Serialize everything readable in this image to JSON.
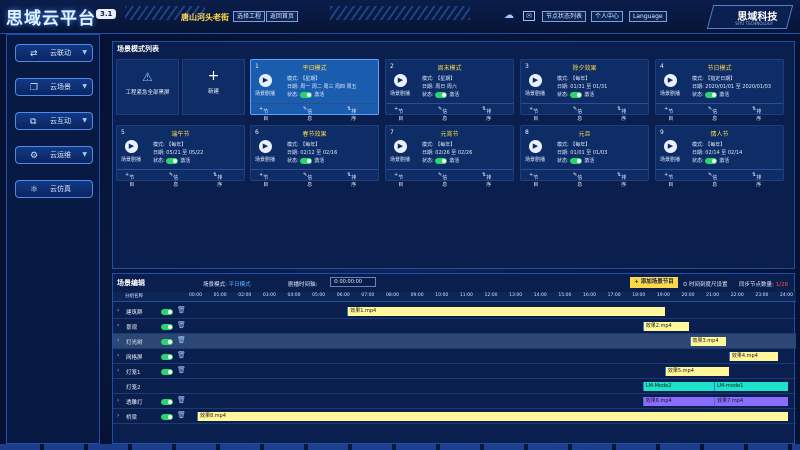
{
  "header": {
    "logo": "思域云平台",
    "version": "3.1",
    "location": "唐山河头老街",
    "btn_select": "选择工程",
    "btn_home": "返回首页",
    "btn_node_status": "节点状态列表",
    "btn_user": "个人中心",
    "btn_lang": "Language",
    "brand_name": "思域科技",
    "brand_sub": "SIYU TECHNOLOGY"
  },
  "sidebar": {
    "items": [
      {
        "label": "云联动",
        "icon": "link-icon"
      },
      {
        "label": "云场景",
        "icon": "scene-icon"
      },
      {
        "label": "云互动",
        "icon": "interact-icon"
      },
      {
        "label": "云运维",
        "icon": "maintain-icon"
      },
      {
        "label": "云仿真",
        "icon": "simulate-icon"
      }
    ]
  },
  "scenes": {
    "title": "场景模式列表",
    "emergency_label": "工程紧急全部黑屏",
    "add_label": "新建",
    "play_label": "场景剧播",
    "mode_prefix": "模式:",
    "date_prefix": "日期:",
    "status_prefix": "状态:",
    "status_value": "激活",
    "act_node": "节目",
    "act_info": "信息",
    "act_sort": "排序",
    "cards": [
      {
        "num": "1",
        "name": "平日模式",
        "mode": "【星期】",
        "date": "周一 周二 周三 周四 周五",
        "selected": true
      },
      {
        "num": "2",
        "name": "周末模式",
        "mode": "【星期】",
        "date": "周日 周六"
      },
      {
        "num": "3",
        "name": "除夕效果",
        "mode": "【每年】",
        "date": "01/31 至 01/31"
      },
      {
        "num": "4",
        "name": "节日模式",
        "mode": "【指定日期】",
        "date": "2020/01/01 至 2020/01/03"
      },
      {
        "num": "5",
        "name": "端午节",
        "mode": "【每年】",
        "date": "05/21 至 05/22"
      },
      {
        "num": "6",
        "name": "春节效果",
        "mode": "【每年】",
        "date": "02/12 至 02/16"
      },
      {
        "num": "7",
        "name": "元宵节",
        "mode": "【每年】",
        "date": "02/26 至 02/26"
      },
      {
        "num": "8",
        "name": "元旦",
        "mode": "【每年】",
        "date": "01/01 至 01/03"
      },
      {
        "num": "9",
        "name": "情人节",
        "mode": "【每年】",
        "date": "02/14 至 02/14"
      }
    ]
  },
  "editor": {
    "title": "场景编辑",
    "mode_label": "场景模式:",
    "mode_value": "平日模式",
    "time_label": "剧播时间轴:",
    "time_value": "00:00:00",
    "add_node_btn": "+ 添加场景节目",
    "axis_settings": "时间刻度尺设置",
    "sync_label": "同步节点数量:",
    "sync_value": "1/28",
    "group_header": "分组名称",
    "ticks": [
      "00:00",
      "01:00",
      "02:00",
      "03:00",
      "04:00",
      "05:00",
      "06:00",
      "07:00",
      "08:00",
      "09:00",
      "10:00",
      "11:00",
      "12:00",
      "13:00",
      "14:00",
      "15:00",
      "16:00",
      "17:00",
      "18:00",
      "19:00",
      "20:00",
      "21:00",
      "22:00",
      "23:00",
      "24:00"
    ],
    "rows": [
      {
        "name": "建筑群",
        "expand": true,
        "toggle": true,
        "bars": [
          {
            "label": "效果1.mp4",
            "start": 6.1,
            "end": 19.0,
            "color": "#fff79a"
          }
        ]
      },
      {
        "name": "景观",
        "expand": true,
        "toggle": true,
        "bars": [
          {
            "label": "效果2.mp4",
            "start": 18.1,
            "end": 20.0,
            "color": "#fff79a"
          }
        ]
      },
      {
        "name": "灯光树",
        "expand": true,
        "toggle": true,
        "highlight": true,
        "bars": [
          {
            "label": "效果3.mp4",
            "start": 20.0,
            "end": 21.5,
            "color": "#fff79a"
          }
        ]
      },
      {
        "name": "网格屏",
        "expand": true,
        "toggle": true,
        "bars": [
          {
            "label": "效果4.mp4",
            "start": 21.6,
            "end": 23.6,
            "color": "#fff79a"
          }
        ]
      },
      {
        "name": "灯笼1",
        "expand": true,
        "toggle": true,
        "bars": [
          {
            "label": "效果5.mp4",
            "start": 19.0,
            "end": 21.6,
            "color": "#fff79a"
          }
        ]
      },
      {
        "name": "灯笼2",
        "expand": false,
        "toggle": false,
        "bars": [
          {
            "label": "LM-Mode2",
            "start": 18.1,
            "end": 21.0,
            "color": "#1fe3c8"
          },
          {
            "label": "LM-mode1",
            "start": 21.0,
            "end": 24.0,
            "color": "#1fe3c8"
          }
        ]
      },
      {
        "name": "透雕灯",
        "expand": true,
        "toggle": true,
        "bars": [
          {
            "label": "效果6.mp4",
            "start": 18.1,
            "end": 21.0,
            "color": "#8a6cff"
          },
          {
            "label": "效果7.mp4",
            "start": 21.0,
            "end": 24.0,
            "color": "#8a6cff"
          }
        ]
      },
      {
        "name": "桥梁",
        "expand": true,
        "toggle": true,
        "bars": [
          {
            "label": "效果8.mp4",
            "start": 0.0,
            "end": 24.0,
            "color": "#fff79a"
          }
        ]
      }
    ]
  }
}
